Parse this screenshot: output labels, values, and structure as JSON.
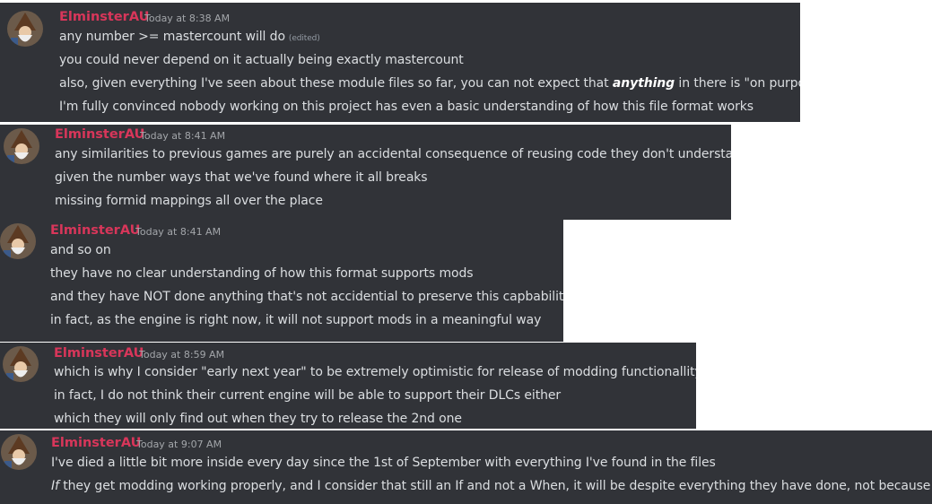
{
  "messages": [
    {
      "author": "ElminsterAU",
      "timestamp": "Today at 8:38 AM",
      "lines": [
        {
          "text": "any number >= mastercount will do",
          "edited": "(edited)"
        },
        {
          "text": "you could never depend on it actually being exactly mastercount"
        },
        {
          "pre": "also, given everything I've seen about these module files so far, you can not expect that ",
          "emph": "anything",
          "post": " in there is \"on purpose\""
        },
        {
          "text": "I'm fully convinced nobody working on this project has even a basic understanding of how this file format works"
        }
      ]
    },
    {
      "author": "ElminsterAU",
      "timestamp": "Today at 8:41 AM",
      "lines": [
        {
          "text": "any similarities to previous games are purely an accidental consequence of reusing code they don't understand"
        },
        {
          "text": "given the number ways that we've found where it all breaks"
        },
        {
          "text": "missing formid mappings all over the place"
        }
      ]
    },
    {
      "author": "ElminsterAU",
      "timestamp": "Today at 8:41 AM",
      "lines": [
        {
          "text": "and so on"
        },
        {
          "text": "they have no clear understanding of how this format supports mods"
        },
        {
          "text": "and they have NOT done anything that's not accidential to preserve this capbability"
        },
        {
          "text": "in fact, as the engine is right now, it will not support mods in a meaningful way"
        }
      ]
    },
    {
      "author": "ElminsterAU",
      "timestamp": "Today at 8:59 AM",
      "lines": [
        {
          "text": "which is why I consider \"early next year\" to be extremely optimistic for release of modding functionallity"
        },
        {
          "text": "in fact, I do not think their current engine will be able to support their DLCs either"
        },
        {
          "text": "which they will only find out when they try to release the 2nd one"
        }
      ]
    },
    {
      "author": "ElminsterAU",
      "timestamp": "Today at 9:07 AM",
      "lines": [
        {
          "text": "I've died a little bit more inside every day since the 1st of September with everything I've found in the files"
        },
        {
          "emph_i": "If",
          "post": " they get modding working properly, and I consider that still an If and not a When, it will be despite everything they have done, not because of it"
        }
      ]
    }
  ],
  "colors": {
    "background": "#313338",
    "username": "#d8365a",
    "text": "#dbdee1",
    "timestamp": "#a3a6aa"
  },
  "icons": {
    "avatar": "wizard-avatar-icon",
    "truncated_emoji": "emoji-icon"
  }
}
